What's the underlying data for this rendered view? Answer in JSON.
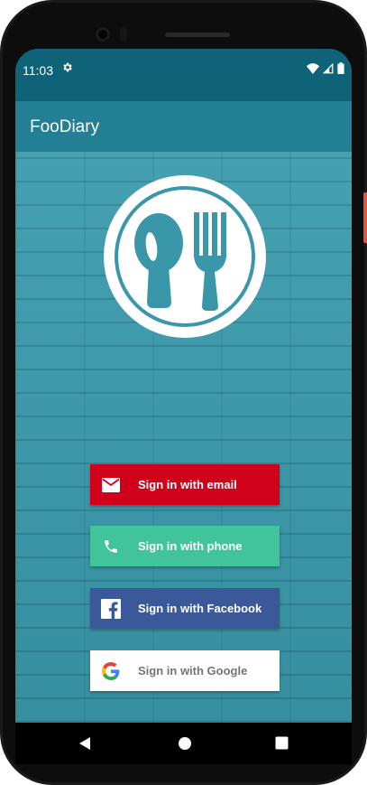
{
  "status_bar": {
    "time": "11:03",
    "icons": [
      "settings-icon",
      "wifi-icon",
      "signal-icon",
      "battery-icon"
    ]
  },
  "app_bar": {
    "title": "FooDiary"
  },
  "logo": {
    "icon": "spoon-fork-logo-icon"
  },
  "buttons": {
    "email": {
      "label": "Sign in with email",
      "icon": "mail-icon",
      "color": "#d0021b"
    },
    "phone": {
      "label": "Sign in with phone",
      "icon": "phone-icon",
      "color": "#42c49a"
    },
    "facebook": {
      "label": "Sign in with Facebook",
      "icon": "facebook-icon",
      "color": "#3b5998"
    },
    "google": {
      "label": "Sign in with Google",
      "icon": "google-icon",
      "color": "#ffffff"
    }
  },
  "navigation": {
    "buttons": [
      "back-icon",
      "home-icon",
      "recents-icon"
    ]
  },
  "colors": {
    "status_bar": "#0e6378",
    "app_bar": "#237f94",
    "background": "#3b9bad"
  }
}
